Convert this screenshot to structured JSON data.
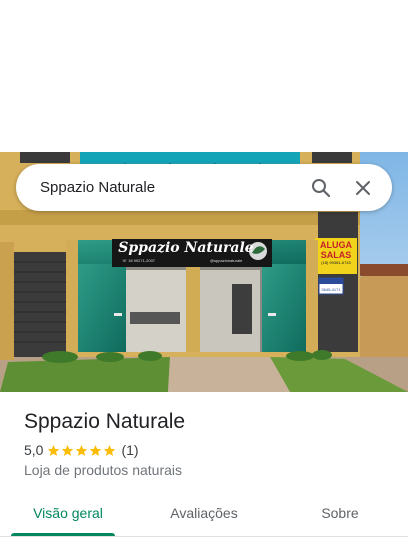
{
  "search": {
    "query": "Sppazio Naturale"
  },
  "photo": {
    "sign_text": "Sppazio Naturale",
    "sign_phone": "☏ 18 99271-2007",
    "sign_handle": "@sppazionaturale",
    "rent_sign": {
      "line1": "ALUGA",
      "line2": "SALAS",
      "phone": "(18) 99381-6743"
    },
    "small_sign_phone": "3645-4171"
  },
  "place": {
    "name": "Sppazio Naturale",
    "rating": "5,0",
    "stars": 5,
    "review_count": "(1)",
    "category": "Loja de produtos naturais"
  },
  "tabs": [
    {
      "label": "Visão geral",
      "active": true
    },
    {
      "label": "Avaliações",
      "active": false
    },
    {
      "label": "Sobre",
      "active": false
    }
  ],
  "colors": {
    "accent": "#01875f",
    "star": "#fbbc04"
  }
}
